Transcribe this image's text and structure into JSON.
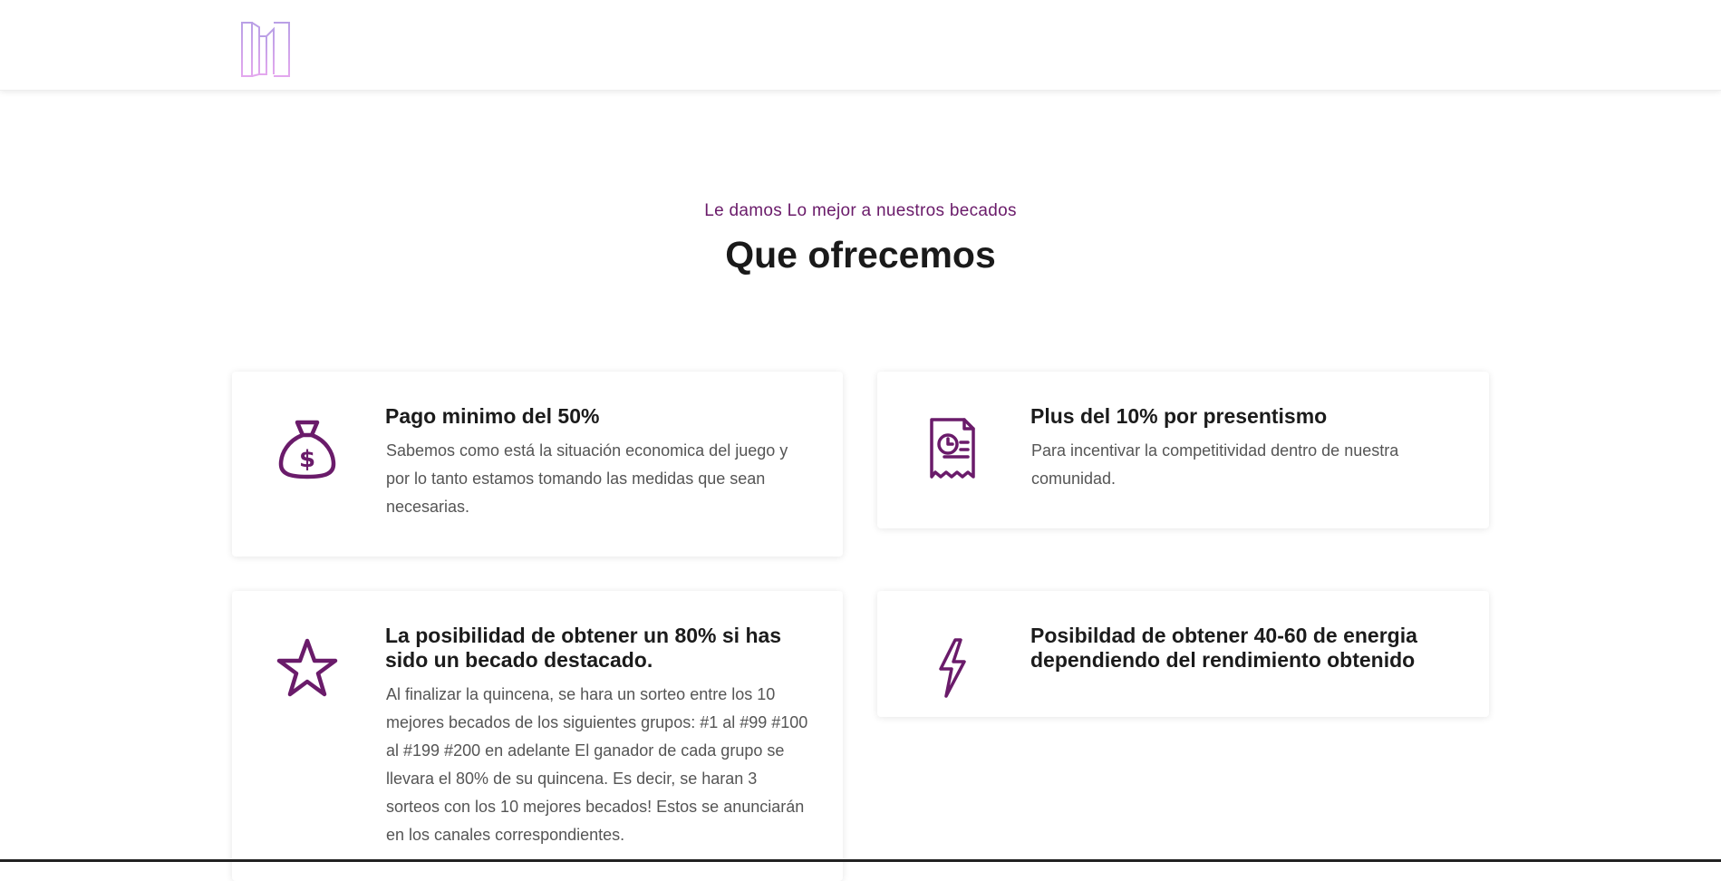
{
  "header": {
    "logo_icon": "brand-logo-icon"
  },
  "section": {
    "eyebrow": "Le damos Lo mejor a nuestros becados",
    "title": "Que ofrecemos"
  },
  "colors": {
    "accent": "#6a1b6a",
    "title": "#1b1b1b",
    "text": "#555555"
  },
  "cards": [
    {
      "icon": "money-bag-icon",
      "title": "Pago minimo del 50%",
      "text": "Sabemos como está la situación economica del juego y por lo tanto estamos tomando las medidas que sean necesarias."
    },
    {
      "icon": "receipt-clock-icon",
      "title": "Plus del 10% por presentismo",
      "text": "Para incentivar la competitividad dentro de nuestra comunidad."
    },
    {
      "icon": "star-icon",
      "title": "La posibilidad de obtener un 80% si has sido un becado destacado.",
      "text": "Al finalizar la quincena, se hara un sorteo entre los 10 mejores becados de los siguientes grupos: #1 al #99 #100 al #199 #200 en adelante El ganador de cada grupo se llevara el 80% de su quincena. Es decir, se haran 3 sorteos con los 10 mejores becados! Estos se anunciarán en los canales correspondientes."
    },
    {
      "icon": "lightning-icon",
      "title": "Posibildad de obtener 40-60 de energia dependiendo del rendimiento obtenido",
      "text": ""
    }
  ]
}
